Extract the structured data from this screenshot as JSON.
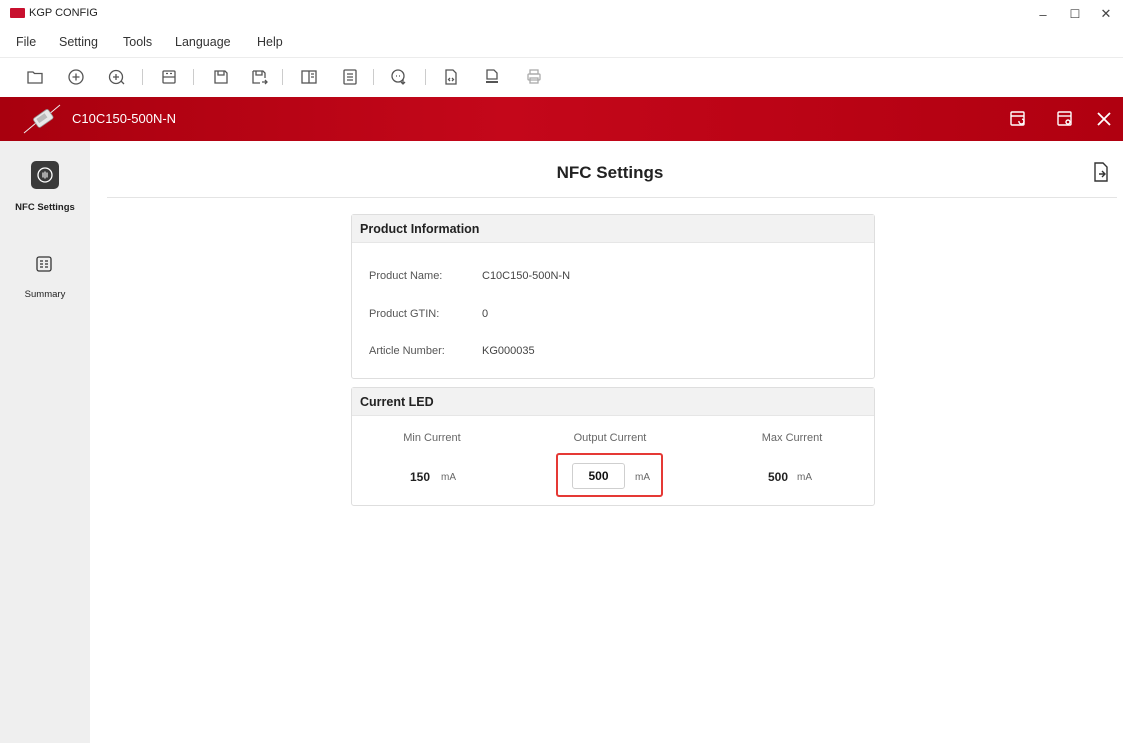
{
  "app": {
    "title": "KGP CONFIG"
  },
  "window_controls": {
    "minimize": "–",
    "maximize": "☐",
    "close": "✕"
  },
  "menu": [
    "File",
    "Setting",
    "Tools",
    "Language",
    "Help"
  ],
  "toolbar_icons": [
    "open-folder-icon",
    "add-circle-icon",
    "add-device-icon",
    "read-device-icon",
    "save-icon",
    "save-as-icon",
    "compare-icon",
    "document-icon",
    "download-icon",
    "export-code-icon",
    "export-html-icon",
    "print-icon"
  ],
  "device": {
    "name": "C10C150-500N-N"
  },
  "sidebar": {
    "items": [
      {
        "label": "NFC Settings",
        "icon": "nfc-icon",
        "active": true
      },
      {
        "label": "Summary",
        "icon": "summary-icon",
        "active": false
      }
    ]
  },
  "page": {
    "title": "NFC Settings"
  },
  "product_info": {
    "header": "Product Information",
    "rows": [
      {
        "label": "Product Name:",
        "value": "C10C150-500N-N"
      },
      {
        "label": "Product GTIN:",
        "value": "0"
      },
      {
        "label": "Article Number:",
        "value": "KG000035"
      }
    ]
  },
  "current_led": {
    "header": "Current LED",
    "min_label": "Min Current",
    "output_label": "Output Current",
    "max_label": "Max Current",
    "min_value": "150",
    "output_value": "500",
    "max_value": "500",
    "unit": "mA"
  },
  "colors": {
    "brand_red": "#c4071a",
    "highlight": "#e53935",
    "sidebar_bg": "#efefef"
  }
}
